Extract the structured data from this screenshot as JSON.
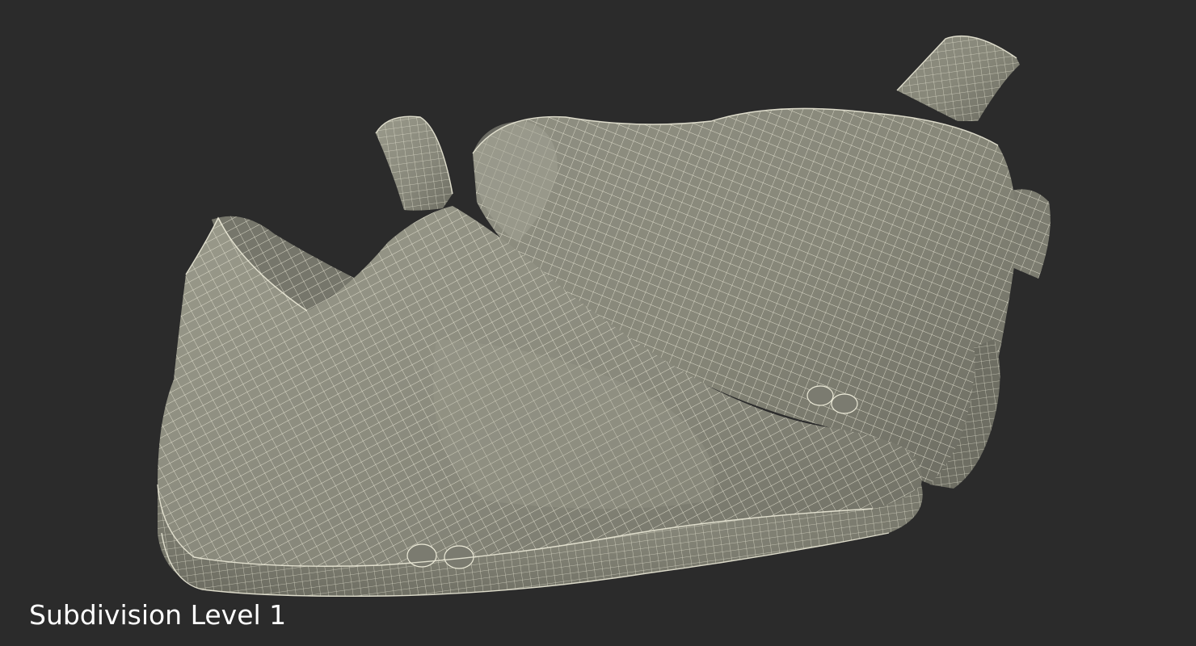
{
  "viewport": {
    "background_color": "#2b2b2b",
    "caption": "Subdivision Level 1"
  },
  "model": {
    "surface_color": "#8b8b7d",
    "shadow_color": "#5f5f55",
    "wire_color": "#ecead8"
  }
}
